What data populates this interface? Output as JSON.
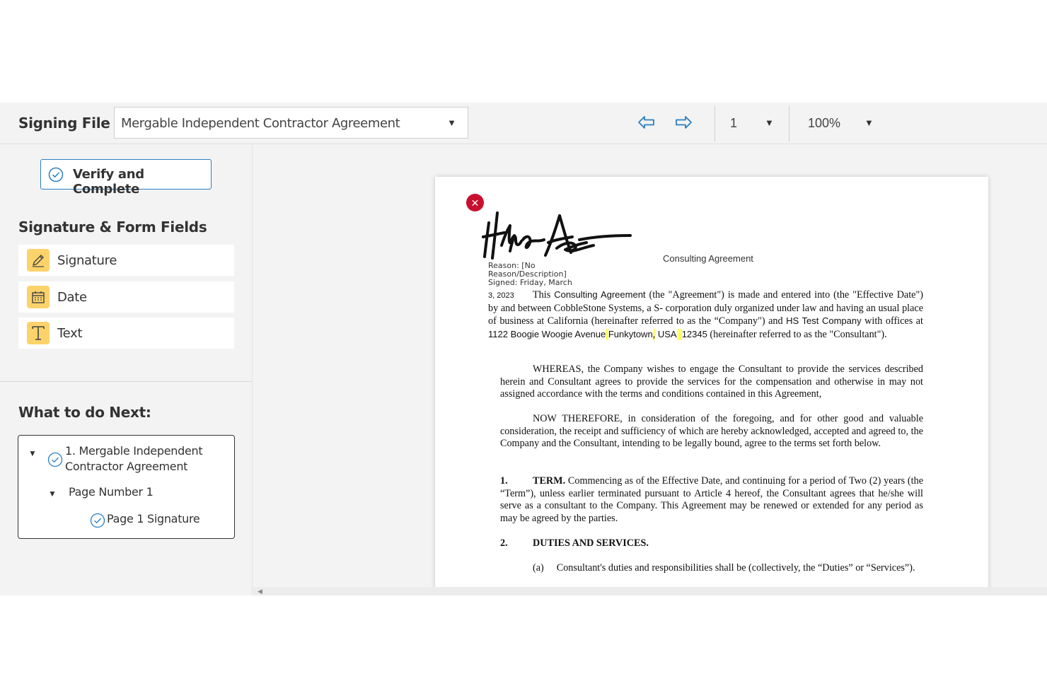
{
  "toolbar": {
    "signing_file_label": "Signing File :",
    "file_name": "Mergable Independent Contractor Agreement",
    "page_number": "1",
    "zoom": "100%"
  },
  "sidebar": {
    "verify_button": "Verify and Complete",
    "fields_title": "Signature & Form Fields",
    "fields": [
      {
        "label": "Signature",
        "icon": "pen-icon"
      },
      {
        "label": "Date",
        "icon": "calendar-icon"
      },
      {
        "label": "Text",
        "icon": "text-t-icon"
      }
    ],
    "next_title": "What to do Next:",
    "tree": {
      "document": "1. Mergable Independent Contractor Agreement",
      "page": "Page Number 1",
      "task": "Page 1 Signature"
    }
  },
  "document": {
    "title": "Consulting Agreement",
    "sig_reason": "Reason: [No Reason/Description]",
    "sig_signed": "Signed: Friday, March",
    "sig_date": "3, 2023",
    "p1": {
      "a": "This ",
      "b": "Consulting Agreement",
      "c": " (the \"Agreement\") is made and entered into  (the \"Effective Date\") by and between CobbleStone Systems, a S- corporation duly organized under law and having an usual place of business at  California (hereinafter referred to as the “Company\") and ",
      "d": "HS Test Company",
      "e": " with offices at ",
      "f": "1122 Boogie Woogie Avenue",
      "g": "Funkytown",
      "h": "USA",
      "i": "12345",
      "j": " (hereinafter referred to as the \"Consultant\")."
    },
    "p2": "WHEREAS, the Company wishes to engage the Consultant to provide the services described herein and Consultant agrees to provide the services for the compensation and otherwise in may not assigned accordance with the terms and conditions contained in this Agreement,",
    "p3": "NOW THEREFORE, in consideration of the foregoing, and for other good and valuable consideration, the receipt and sufficiency of which are hereby acknowledged, accepted and agreed to, the Company and the Consultant, intending to be legally bound, agree to the terms set forth below.",
    "s1_num": "1.",
    "s1_head": "TERM.",
    "s1_body": " Commencing as of the Effective Date, and continuing for a period of Two (2) years (the “Term”), unless earlier terminated pursuant to Article 4 hereof, the Consultant agrees that he/she will serve as a consultant to the Company.  This Agreement may be renewed or extended for any period as may be agreed by the parties.",
    "s2_num": "2.",
    "s2_head": "DUTIES AND SERVICES.",
    "s2a_num": "(a)",
    "s2a_body": "Consultant's duties and responsibilities shall be (collectively, the “Duties” or “Services”)."
  },
  "colors": {
    "accent_blue": "#2a7fc1",
    "field_icon_bg": "#fcd36b",
    "remove_red": "#c8102e",
    "highlight": "#ffff6a"
  }
}
